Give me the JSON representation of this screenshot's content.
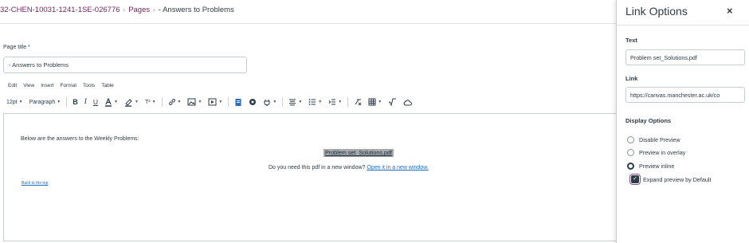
{
  "breadcrumb": {
    "course": "32-CHEN-10031-1241-1SE-026776",
    "pages": "Pages",
    "current": "- Answers to Problems",
    "separator": "›"
  },
  "editor": {
    "title_label": "Page title *",
    "title_value": "- Answers to Problems",
    "menu": [
      "Edit",
      "View",
      "Insert",
      "Format",
      "Tools",
      "Table"
    ],
    "toolbar": {
      "font_size": "12pt",
      "block_format": "Paragraph",
      "bold": "B",
      "italic": "I",
      "underline": "U",
      "superscript": "T²"
    },
    "content": {
      "intro": "Below are the answers to the Weekly Problems:",
      "pdf_link": "Problem set_Solutions.pdf",
      "question": "Do you need this pdf in a new window?",
      "open_link": "Open it in a new window.",
      "back_to_top": "Back to the top"
    }
  },
  "tray": {
    "title": "Link Options",
    "close": "×",
    "text_label": "Text",
    "text_value": "Problem set_Solutions.pdf",
    "link_label": "Link",
    "link_value": "https://canvas.manchester.ac.uk/co",
    "display_label": "Display Options",
    "options": [
      "Disable Preview",
      "Preview in overlay",
      "Preview inline"
    ],
    "selected_option": "Preview inline",
    "expand_label": "Expand preview by Default",
    "expand_checked": true
  },
  "colors": {
    "breadcrumb_link": "#6b2a5e",
    "link_blue": "#1f6bbf",
    "text": "#2d3b45",
    "selection": "#a3a9ad"
  }
}
